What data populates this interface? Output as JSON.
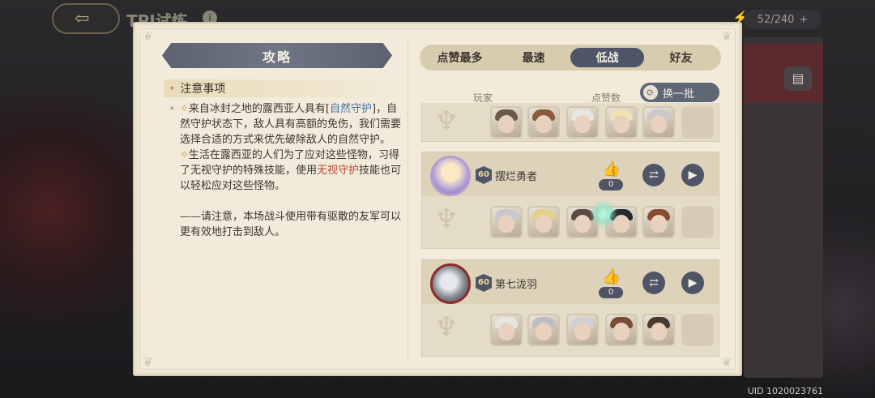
{
  "background": {
    "title": "TPI试炼",
    "stamina": "52/240",
    "stamina_plus": "+",
    "uid": "UID 1020023761"
  },
  "strategy": {
    "title": "攻略",
    "notes_title": "注意事项",
    "para1_a": "来自冰封之地的露西亚人具有[",
    "para1_hl": "自然守护",
    "para1_b": "]，自然守护状态下，敌人具有高额的免伤，我们需要选择合适的方式来优先破除敌人的自然守护。",
    "para2_a": "生活在露西亚的人们为了应对这些怪物，习得了无视守护的特殊技能，使用",
    "para2_hl": "无视守护",
    "para2_b": "技能也可以轻松应对这些怪物。",
    "para3": "——请注意，本场战斗使用带有驱散的友军可以更有效地打击到敌人。"
  },
  "tabs": [
    {
      "label": "点赞最多",
      "active": false
    },
    {
      "label": "最速",
      "active": false
    },
    {
      "label": "低战",
      "active": true
    },
    {
      "label": "好友",
      "active": false
    }
  ],
  "columns": {
    "player": "玩家",
    "likes": "点赞数"
  },
  "refresh_label": "换一批",
  "players": [
    {
      "name": "摆烂勇者",
      "level": "60",
      "likes": "0"
    },
    {
      "name": "第七泷羽",
      "level": "60",
      "likes": "0"
    }
  ],
  "colors": {
    "accent": "#4f5566",
    "panel": "#f2ebdb",
    "link_blue": "#3e6f9e",
    "link_red": "#b44a36"
  }
}
